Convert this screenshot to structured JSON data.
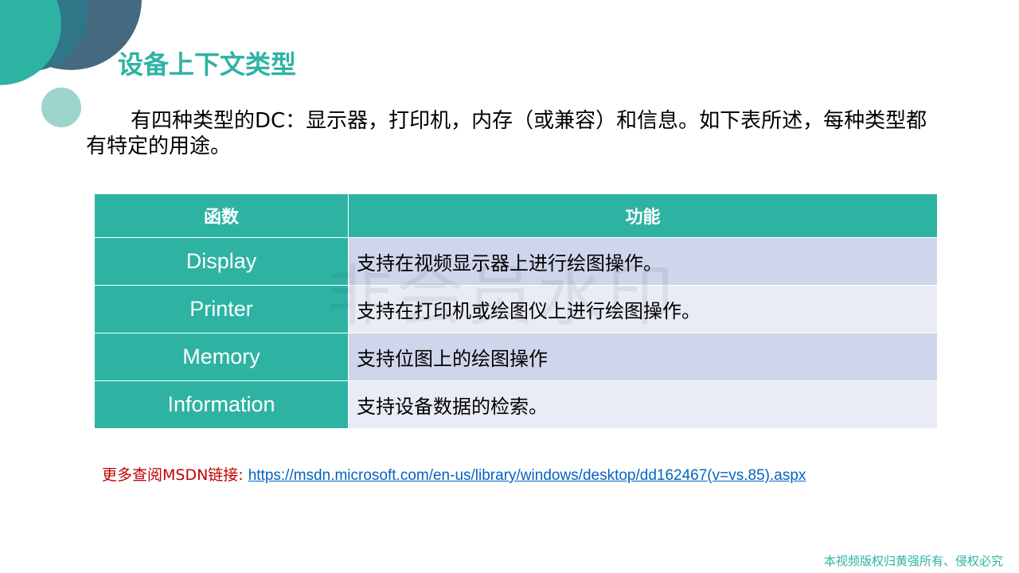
{
  "title": "设备上下文类型",
  "intro": "有四种类型的DC：显示器，打印机，内存（或兼容）和信息。如下表所述，每种类型都有特定的用途。",
  "table": {
    "headers": [
      "函数",
      "功能"
    ],
    "rows": [
      {
        "fn": "Display",
        "desc": "支持在视频显示器上进行绘图操作。"
      },
      {
        "fn": "Printer",
        "desc": "支持在打印机或绘图仪上进行绘图操作。"
      },
      {
        "fn": "Memory",
        "desc": "支持位图上的绘图操作"
      },
      {
        "fn": "Information",
        "desc": "支持设备数据的检索。"
      }
    ]
  },
  "more": {
    "label": "更多查阅MSDN链接:",
    "url": "https://msdn.microsoft.com/en-us/library/windows/desktop/dd162467(v=vs.85).aspx"
  },
  "copyright": "本视频版权归黄强所有、侵权必究",
  "watermark": "非会员水印",
  "colors": {
    "accent": "#2eb3a3",
    "dark": "#456a80",
    "light": "#9dd4cc",
    "link": "#0563c1",
    "red": "#c00000"
  }
}
